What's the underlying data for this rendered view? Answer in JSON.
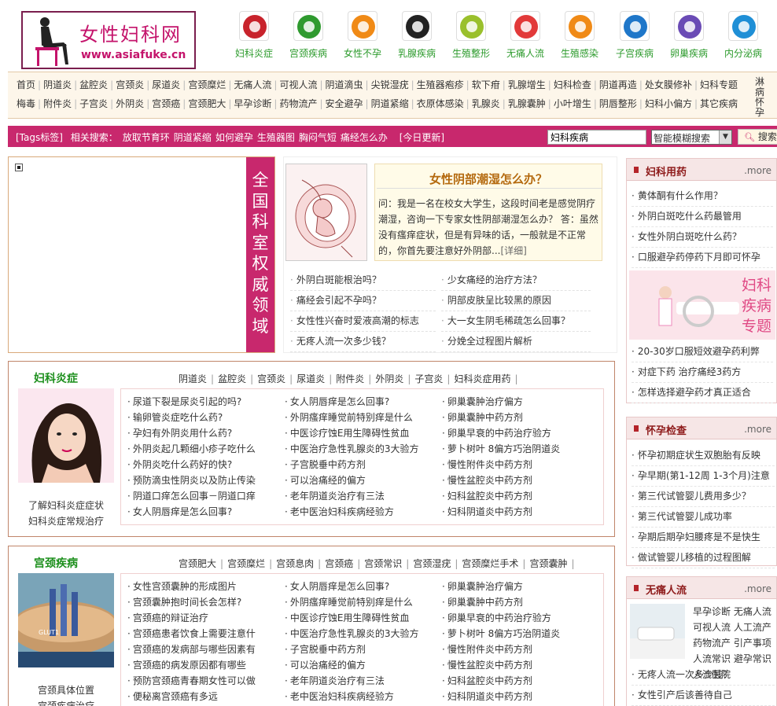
{
  "logo": {
    "title": "女性妇科网",
    "url": "www.asiafuke.cn"
  },
  "nav_icons": [
    {
      "label": "妇科炎症",
      "icon": "umbrella-icon"
    },
    {
      "label": "宫颈疾病",
      "icon": "puzzle-icon"
    },
    {
      "label": "女性不孕",
      "icon": "baby-icon"
    },
    {
      "label": "乳腺疾病",
      "icon": "glasses-icon"
    },
    {
      "label": "生殖整形",
      "icon": "hand-icon"
    },
    {
      "label": "无痛人流",
      "icon": "ball-icon"
    },
    {
      "label": "生殖感染",
      "icon": "note-icon"
    },
    {
      "label": "子宫疾病",
      "icon": "wheel-icon"
    },
    {
      "label": "卵巢疾病",
      "icon": "gear-icon"
    },
    {
      "label": "内分泌病",
      "icon": "snowflake-icon"
    }
  ],
  "nav_row1": [
    "首页",
    "阴道炎",
    "盆腔炎",
    "宫颈炎",
    "尿道炎",
    "宫颈糜烂",
    "无痛人流",
    "可视人流",
    "阴道滴虫",
    "尖锐湿疣",
    "生殖器疱疹",
    "软下疳",
    "乳腺增生",
    "妇科检查",
    "阴道再造",
    "处女膜修补",
    "妇科专题"
  ],
  "nav_row2": [
    "梅毒",
    "附件炎",
    "子宫炎",
    "外阴炎",
    "宫颈癌",
    "宫颈肥大",
    "早孕诊断",
    "药物流产",
    "安全避孕",
    "阴道紧缩",
    "衣原体感染",
    "乳腺炎",
    "乳腺囊肿",
    "小叶增生",
    "阴唇整形",
    "妇科小偏方",
    "其它疾病"
  ],
  "nav_last": "淋病怀孕",
  "search": {
    "tag_label": "[Tags标签]",
    "related_label": "相关搜索：",
    "related": [
      "放取节育环",
      "阴道紧缩",
      "如何避孕",
      "生殖器图",
      "胸闷气短",
      "痛经怎么办"
    ],
    "today": "[今日更新]",
    "value": "妇科疾病",
    "mode": "智能模糊搜索",
    "button": "搜索"
  },
  "ad": {
    "vertical_text": "全国科室权威领域"
  },
  "featured": {
    "title": "女性阴部潮湿怎么办？",
    "text": "问：我是一名在校女大学生，这段时间老是感觉阴疗潮湿，咨询一下专家女性阴部潮湿怎么办？ 答：虽然没有瘙痒症状，但是有异味的话，一般就是不正常的，你首先要注意好外阴部...",
    "more": "[详细]",
    "links_left": [
      "外阴白斑能根治吗？",
      "痛经会引起不孕吗？",
      "女性性兴奋时爱液高潮的标志",
      "无疼人流一次多少钱？"
    ],
    "links_right": [
      "少女痛经的治疗方法？",
      "阴部皮肤呈比较黑的原因",
      "大一女生阴毛稀疏怎么回事？",
      "分娩全过程图片解析"
    ]
  },
  "sec1": {
    "title": "妇科炎症",
    "tabs": [
      "阴道炎",
      "盆腔炎",
      "宫颈炎",
      "尿道炎",
      "附件炎",
      "外阴炎",
      "子宫炎",
      "妇科炎症用药"
    ],
    "caption": [
      "了解妇科炎症症状",
      "妇科炎症常规治疗"
    ],
    "col1": [
      "尿道下裂是尿炎引起的吗?",
      "输卵管炎症吃什么药?",
      "孕妇有外阴炎用什么药?",
      "外阴炎起几颗细小疹子吃什么",
      "外阴炎吃什么药好的快?",
      "预防滴虫性阴炎以及防止传染",
      "阴道口痒怎么回事－阴道口痒",
      "女人阴唇痒是怎么回事?"
    ],
    "col2": [
      "女人阴唇痒是怎么回事?",
      "外阴瘙痒睡觉前特别痒是什么",
      "中医诊疗蚀E用生障碍性贫血",
      "中医治疗急性乳腺炎的3大验方",
      "子宫脱垂中药方剂",
      "可以治痛经的偏方",
      "老年阴道炎治疗有三法",
      "老中医治妇科疾病经验方"
    ],
    "col3": [
      "卵巢囊肿治疗偏方",
      "卵巢囊肿中药方剂",
      "卵巢早衰的中药治疗验方",
      "萝卜树叶 8偏方巧治阴道炎",
      "慢性附件炎中药方剂",
      "慢性盆腔炎中药方剂",
      "妇科盆腔炎中药方剂",
      "妇科阴道炎中药方剂"
    ]
  },
  "sec2": {
    "title": "宫颈疾病",
    "tabs": [
      "宫颈肥大",
      "宫颈糜烂",
      "宫颈息肉",
      "宫颈癌",
      "宫颈常识",
      "宫颈湿疣",
      "宫颈糜烂手术",
      "宫颈囊肿"
    ],
    "caption": [
      "宫颈具体位置",
      "宫颈疾病治疗"
    ],
    "col1": [
      "女性宫颈囊肿的形成图片",
      "宫颈囊肿抱时间长会怎样?",
      "宫颈癌的辩证治疗",
      "宫颈癌患者饮食上需要注意什",
      "宫颈癌的发病部与哪些因素有",
      "宫颈癌的病发原因都有哪些",
      "预防宫颈癌青春期女性可以做",
      "便秘离宫颈癌有多远"
    ],
    "col2": [
      "女人阴唇痒是怎么回事?",
      "外阴瘙痒睡觉前特别痒是什么",
      "中医诊疗蚀E用生障碍性贫血",
      "中医治疗急性乳腺炎的3大验方",
      "子宫脱垂中药方剂",
      "可以治痛经的偏方",
      "老年阴道炎治疗有三法",
      "老中医治妇科疾病经验方"
    ],
    "col3": [
      "卵巢囊肿治疗偏方",
      "卵巢囊肿中药方剂",
      "卵巢早衰的中药治疗验方",
      "萝卜树叶 8偏方巧治阴道炎",
      "慢性附件炎中药方剂",
      "慢性盆腔炎中药方剂",
      "妇科盆腔炎中药方剂",
      "妇科阴道炎中药方剂"
    ]
  },
  "right1": {
    "title": "妇科用药",
    "more": ".more",
    "links": [
      "黄体酮有什么作用？",
      "外阴白斑吃什么药最管用",
      "女性外阴白斑吃什么药？",
      "口服避孕药停药下月即可怀孕"
    ],
    "banner": "妇科疾病专题",
    "links2": [
      "20-30岁口服短效避孕药利弊",
      "对症下药 治疗痛经3药方",
      "怎样选择避孕药才真正适合"
    ]
  },
  "right2": {
    "title": "怀孕检查",
    "more": ".more",
    "links": [
      "怀孕初期症状生双胞胎有反映",
      "孕早期(第1-12周 1-3个月)注意",
      "第三代试管婴儿费用多少？",
      "第三代试管婴儿成功率",
      "孕期后期孕妇腰疼是不是快生",
      "做试管婴儿移植的过程图解"
    ]
  },
  "right3": {
    "title": "无痛人流",
    "more": ".more",
    "tags": "早孕诊断 无痛人流 可视人流 人工流产 药物流产 引产事项 人流常识 避孕常识 人流医院",
    "links": [
      "无疼人流一次多少钱？",
      "女性引产后该善待自己"
    ]
  }
}
